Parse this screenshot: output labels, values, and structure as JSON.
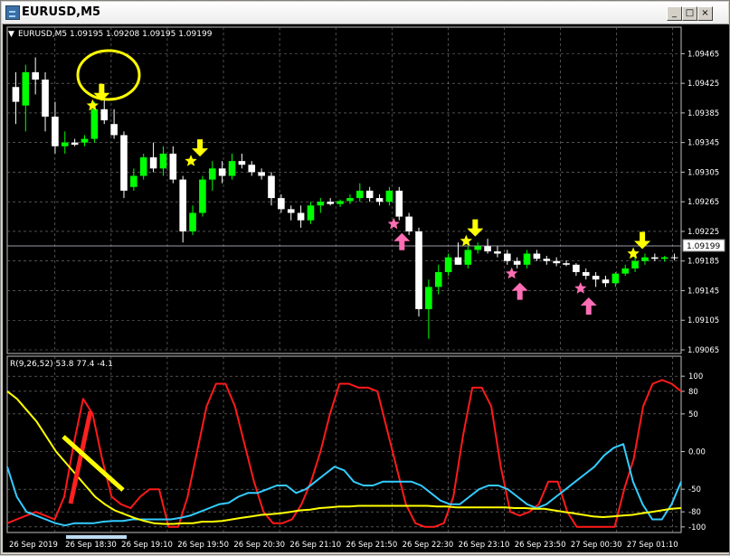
{
  "window": {
    "title": "EURUSD,M5",
    "buttons": {
      "minimize": "_",
      "maximize": "□",
      "close": "×"
    }
  },
  "price_chart": {
    "header": "EURUSD,M5  1.09195 1.09208 1.09195 1.09199",
    "symbol_menu_glyph": "▼",
    "current_price": "1.09199",
    "y_ticks": [
      "1.09465",
      "1.09425",
      "1.09385",
      "1.09345",
      "1.09305",
      "1.09265",
      "1.09225",
      "1.09185",
      "1.09145",
      "1.09105",
      "1.09065"
    ],
    "y_range": [
      1.09065,
      1.09485
    ],
    "colors": {
      "background": "#000000",
      "bull_candle": "#00ff00",
      "bear_candle": "#ffffff",
      "grid": "#808080",
      "signal_sell": "#ffff00",
      "signal_buy": "#ff6eb4",
      "annotation": "#ffff00"
    }
  },
  "indicator": {
    "header": "R(9,26,52) 53.8 77.4 -4.1",
    "y_ticks": [
      "100",
      "80",
      "50",
      "0.00",
      "-50",
      "-80",
      "-100"
    ],
    "y_range": [
      -105,
      105
    ],
    "colors": {
      "red": "#ff1a1a",
      "cyan": "#33ccff",
      "yellow": "#ffff00",
      "annotation_red": "#ff2020",
      "annotation_yellow": "#ffff00"
    }
  },
  "time_axis": {
    "labels": [
      "26 Sep 2019",
      "26 Sep 18:30",
      "26 Sep 19:10",
      "26 Sep 19:50",
      "26 Sep 20:30",
      "26 Sep 21:10",
      "26 Sep 21:50",
      "26 Sep 22:30",
      "26 Sep 23:10",
      "26 Sep 23:50",
      "27 Sep 00:30",
      "27 Sep 01:10"
    ]
  },
  "chart_data": {
    "type": "candlestick",
    "symbol": "EURUSD",
    "timeframe": "M5",
    "candles": [
      {
        "o": 1.0942,
        "h": 1.0944,
        "l": 1.0937,
        "c": 1.094
      },
      {
        "o": 1.09395,
        "h": 1.0945,
        "l": 1.0936,
        "c": 1.0944
      },
      {
        "o": 1.0944,
        "h": 1.0946,
        "l": 1.0941,
        "c": 1.0943
      },
      {
        "o": 1.0943,
        "h": 1.0944,
        "l": 1.0936,
        "c": 1.0938
      },
      {
        "o": 1.0938,
        "h": 1.094,
        "l": 1.0933,
        "c": 1.0934
      },
      {
        "o": 1.0934,
        "h": 1.0936,
        "l": 1.0933,
        "c": 1.09345
      },
      {
        "o": 1.09345,
        "h": 1.0935,
        "l": 1.0934,
        "c": 1.09342
      },
      {
        "o": 1.09345,
        "h": 1.09355,
        "l": 1.0934,
        "c": 1.0935
      },
      {
        "o": 1.0935,
        "h": 1.094,
        "l": 1.09345,
        "c": 1.0939
      },
      {
        "o": 1.0939,
        "h": 1.0941,
        "l": 1.0937,
        "c": 1.09375
      },
      {
        "o": 1.0937,
        "h": 1.0939,
        "l": 1.0935,
        "c": 1.09355
      },
      {
        "o": 1.09355,
        "h": 1.0936,
        "l": 1.0927,
        "c": 1.0928
      },
      {
        "o": 1.09285,
        "h": 1.0931,
        "l": 1.0928,
        "c": 1.093
      },
      {
        "o": 1.093,
        "h": 1.0933,
        "l": 1.09295,
        "c": 1.09325
      },
      {
        "o": 1.09325,
        "h": 1.09345,
        "l": 1.09305,
        "c": 1.0931
      },
      {
        "o": 1.0931,
        "h": 1.0934,
        "l": 1.093,
        "c": 1.0933
      },
      {
        "o": 1.0933,
        "h": 1.0934,
        "l": 1.0929,
        "c": 1.09295
      },
      {
        "o": 1.09295,
        "h": 1.093,
        "l": 1.0921,
        "c": 1.09225
      },
      {
        "o": 1.09225,
        "h": 1.0926,
        "l": 1.0922,
        "c": 1.0925
      },
      {
        "o": 1.0925,
        "h": 1.093,
        "l": 1.09245,
        "c": 1.09295
      },
      {
        "o": 1.09295,
        "h": 1.0932,
        "l": 1.0928,
        "c": 1.0931
      },
      {
        "o": 1.0931,
        "h": 1.0932,
        "l": 1.0929,
        "c": 1.093
      },
      {
        "o": 1.093,
        "h": 1.0933,
        "l": 1.09295,
        "c": 1.0932
      },
      {
        "o": 1.0932,
        "h": 1.0933,
        "l": 1.0931,
        "c": 1.09315
      },
      {
        "o": 1.09315,
        "h": 1.0932,
        "l": 1.093,
        "c": 1.09305
      },
      {
        "o": 1.09305,
        "h": 1.0931,
        "l": 1.09295,
        "c": 1.093
      },
      {
        "o": 1.093,
        "h": 1.09305,
        "l": 1.0926,
        "c": 1.0927
      },
      {
        "o": 1.0927,
        "h": 1.09275,
        "l": 1.0925,
        "c": 1.09255
      },
      {
        "o": 1.09255,
        "h": 1.0926,
        "l": 1.0924,
        "c": 1.0925
      },
      {
        "o": 1.0925,
        "h": 1.0926,
        "l": 1.0923,
        "c": 1.0924
      },
      {
        "o": 1.0924,
        "h": 1.09265,
        "l": 1.09235,
        "c": 1.0926
      },
      {
        "o": 1.0926,
        "h": 1.0927,
        "l": 1.0925,
        "c": 1.09265
      },
      {
        "o": 1.09265,
        "h": 1.0927,
        "l": 1.0926,
        "c": 1.09262
      },
      {
        "o": 1.09262,
        "h": 1.09268,
        "l": 1.09258,
        "c": 1.09266
      },
      {
        "o": 1.09266,
        "h": 1.09275,
        "l": 1.09262,
        "c": 1.0927
      },
      {
        "o": 1.0927,
        "h": 1.0929,
        "l": 1.09265,
        "c": 1.0928
      },
      {
        "o": 1.0928,
        "h": 1.09285,
        "l": 1.09265,
        "c": 1.0927
      },
      {
        "o": 1.0927,
        "h": 1.09275,
        "l": 1.0926,
        "c": 1.09265
      },
      {
        "o": 1.09265,
        "h": 1.09285,
        "l": 1.0926,
        "c": 1.0928
      },
      {
        "o": 1.0928,
        "h": 1.09285,
        "l": 1.0924,
        "c": 1.09245
      },
      {
        "o": 1.09245,
        "h": 1.0925,
        "l": 1.0922,
        "c": 1.09225
      },
      {
        "o": 1.09225,
        "h": 1.0923,
        "l": 1.0911,
        "c": 1.0912
      },
      {
        "o": 1.0912,
        "h": 1.0916,
        "l": 1.0908,
        "c": 1.0915
      },
      {
        "o": 1.0915,
        "h": 1.0918,
        "l": 1.0914,
        "c": 1.0917
      },
      {
        "o": 1.0917,
        "h": 1.09195,
        "l": 1.09165,
        "c": 1.0919
      },
      {
        "o": 1.0919,
        "h": 1.0921,
        "l": 1.0918,
        "c": 1.0918
      },
      {
        "o": 1.0918,
        "h": 1.09205,
        "l": 1.09175,
        "c": 1.092
      },
      {
        "o": 1.092,
        "h": 1.0921,
        "l": 1.09195,
        "c": 1.09205
      },
      {
        "o": 1.09205,
        "h": 1.09215,
        "l": 1.09195,
        "c": 1.09198
      },
      {
        "o": 1.09198,
        "h": 1.09205,
        "l": 1.0919,
        "c": 1.09195
      },
      {
        "o": 1.09195,
        "h": 1.092,
        "l": 1.0918,
        "c": 1.09185
      },
      {
        "o": 1.09185,
        "h": 1.0919,
        "l": 1.09175,
        "c": 1.0918
      },
      {
        "o": 1.0918,
        "h": 1.092,
        "l": 1.09175,
        "c": 1.09195
      },
      {
        "o": 1.09195,
        "h": 1.092,
        "l": 1.09185,
        "c": 1.09188
      },
      {
        "o": 1.09188,
        "h": 1.09192,
        "l": 1.0918,
        "c": 1.09185
      },
      {
        "o": 1.09185,
        "h": 1.0919,
        "l": 1.09178,
        "c": 1.09182
      },
      {
        "o": 1.09182,
        "h": 1.09186,
        "l": 1.09178,
        "c": 1.0918
      },
      {
        "o": 1.0918,
        "h": 1.09182,
        "l": 1.09165,
        "c": 1.0917
      },
      {
        "o": 1.0917,
        "h": 1.09175,
        "l": 1.0916,
        "c": 1.09165
      },
      {
        "o": 1.09165,
        "h": 1.0917,
        "l": 1.0915,
        "c": 1.0916
      },
      {
        "o": 1.0916,
        "h": 1.09165,
        "l": 1.0915,
        "c": 1.09155
      },
      {
        "o": 1.09155,
        "h": 1.0917,
        "l": 1.0915,
        "c": 1.09168
      },
      {
        "o": 1.09168,
        "h": 1.0918,
        "l": 1.09165,
        "c": 1.09175
      },
      {
        "o": 1.09175,
        "h": 1.0919,
        "l": 1.0917,
        "c": 1.09185
      },
      {
        "o": 1.09185,
        "h": 1.09195,
        "l": 1.0918,
        "c": 1.0919
      },
      {
        "o": 1.0919,
        "h": 1.09195,
        "l": 1.09185,
        "c": 1.09188
      },
      {
        "o": 1.09188,
        "h": 1.09192,
        "l": 1.09184,
        "c": 1.0919
      },
      {
        "o": 1.0919,
        "h": 1.09195,
        "l": 1.09186,
        "c": 1.09189
      }
    ],
    "signals": [
      {
        "kind": "sell",
        "index": 8,
        "price": 1.09395
      },
      {
        "kind": "sell",
        "index": 18,
        "price": 1.0932
      },
      {
        "kind": "buy",
        "index": 39,
        "price": 1.09235
      },
      {
        "kind": "sell",
        "index": 46,
        "price": 1.09212
      },
      {
        "kind": "buy",
        "index": 51,
        "price": 1.09168
      },
      {
        "kind": "buy",
        "index": 58,
        "price": 1.09148
      },
      {
        "kind": "sell",
        "index": 63,
        "price": 1.09195
      }
    ],
    "indicator_series": [
      {
        "color": "red",
        "values": [
          -95,
          -90,
          -85,
          -80,
          -85,
          -90,
          -60,
          10,
          70,
          50,
          -10,
          -60,
          -70,
          -75,
          -60,
          -50,
          -50,
          -100,
          -100,
          -60,
          0,
          60,
          90,
          90,
          60,
          10,
          -40,
          -80,
          -95,
          -95,
          -90,
          -70,
          -40,
          0,
          50,
          90,
          90,
          85,
          85,
          80,
          30,
          -20,
          -70,
          -95,
          -100,
          -100,
          -95,
          -60,
          20,
          85,
          85,
          60,
          -20,
          -80,
          -85,
          -80,
          -70,
          -40,
          -40,
          -80,
          -100,
          -100,
          -100,
          -100,
          -100,
          -50,
          -10,
          60,
          90,
          95,
          90,
          80
        ]
      },
      {
        "color": "cyan",
        "values": [
          -20,
          -60,
          -80,
          -85,
          -90,
          -95,
          -98,
          -95,
          -95,
          -95,
          -93,
          -92,
          -92,
          -90,
          -90,
          -90,
          -90,
          -90,
          -88,
          -85,
          -80,
          -75,
          -70,
          -68,
          -60,
          -55,
          -55,
          -50,
          -45,
          -45,
          -55,
          -50,
          -40,
          -30,
          -20,
          -25,
          -40,
          -45,
          -45,
          -40,
          -40,
          -40,
          -40,
          -45,
          -55,
          -65,
          -70,
          -70,
          -60,
          -50,
          -45,
          -45,
          -50,
          -60,
          -70,
          -75,
          -70,
          -60,
          -50,
          -40,
          -30,
          -20,
          -5,
          5,
          10,
          -40,
          -70,
          -90,
          -90,
          -70,
          -40
        ]
      },
      {
        "color": "yellow",
        "values": [
          80,
          70,
          55,
          40,
          20,
          0,
          -15,
          -30,
          -45,
          -60,
          -70,
          -78,
          -83,
          -88,
          -92,
          -95,
          -96,
          -96,
          -95,
          -95,
          -93,
          -93,
          -92,
          -90,
          -88,
          -86,
          -84,
          -83,
          -82,
          -80,
          -78,
          -77,
          -75,
          -74,
          -73,
          -73,
          -72,
          -72,
          -72,
          -72,
          -72,
          -72,
          -72,
          -72,
          -73,
          -73,
          -74,
          -74,
          -74,
          -74,
          -74,
          -74,
          -75,
          -75,
          -76,
          -76,
          -78,
          -80,
          -82,
          -84,
          -86,
          -87,
          -86,
          -85,
          -84,
          -82,
          -80,
          -78,
          -76,
          -75
        ]
      }
    ]
  }
}
